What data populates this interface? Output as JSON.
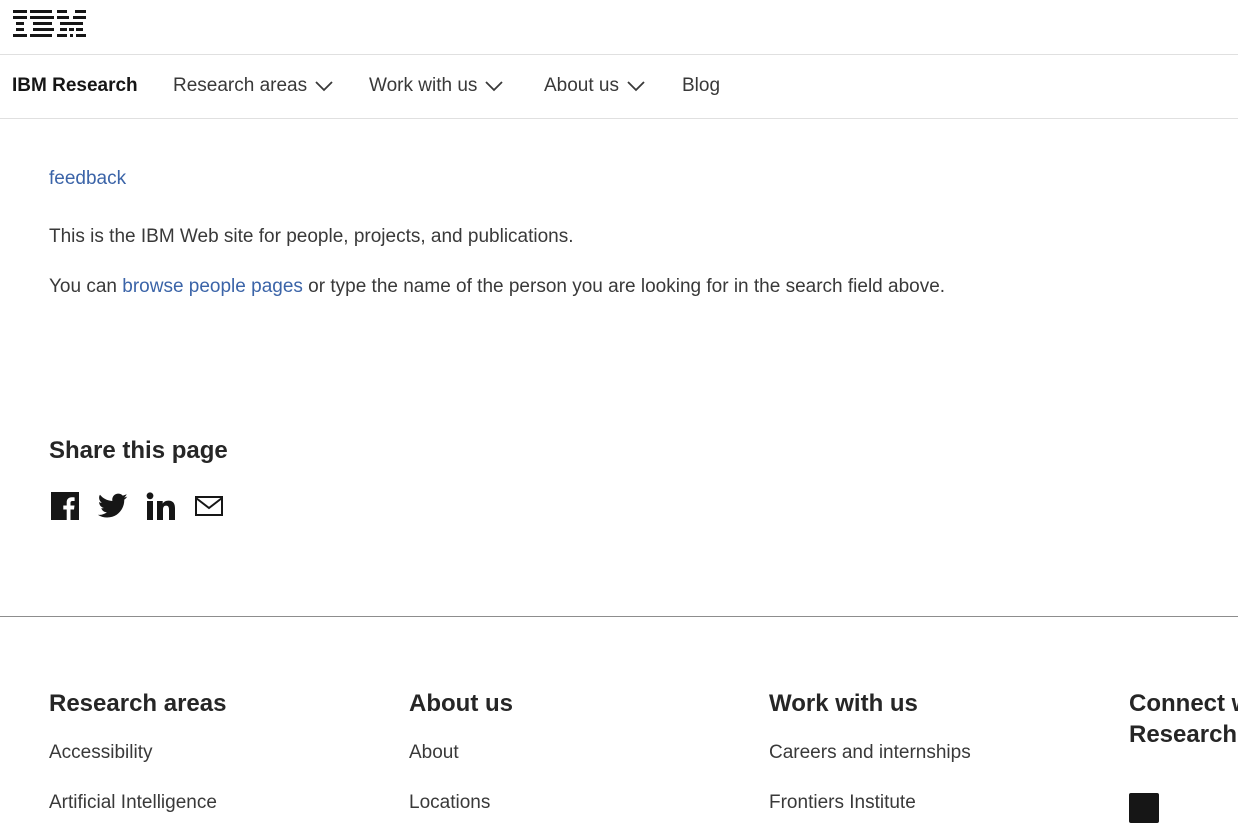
{
  "masthead": {
    "logo_text": "IBM"
  },
  "subnav": {
    "brand": "IBM Research",
    "items": [
      {
        "label": "Research areas",
        "has_dropdown": true
      },
      {
        "label": "Work with us",
        "has_dropdown": true
      },
      {
        "label": "About us",
        "has_dropdown": true
      },
      {
        "label": "Blog",
        "has_dropdown": false
      }
    ]
  },
  "main": {
    "feedback_link": "feedback",
    "intro": "This is the IBM Web site for people, projects, and publications.",
    "browse_prefix": "You can ",
    "browse_link": "browse people pages",
    "browse_suffix": " or type the name of the person you are looking for in the search field above."
  },
  "share": {
    "title": "Share this page",
    "icons": [
      "facebook-icon",
      "twitter-icon",
      "linkedin-icon",
      "email-icon"
    ]
  },
  "footer": {
    "columns": [
      {
        "heading": "Research areas",
        "links": [
          "Accessibility",
          "Artificial Intelligence"
        ]
      },
      {
        "heading": "About us",
        "links": [
          "About",
          "Locations"
        ]
      },
      {
        "heading": "Work with us",
        "links": [
          "Careers and internships",
          "Frontiers Institute"
        ]
      },
      {
        "heading": "Connect with IBM Research",
        "links": []
      }
    ]
  },
  "colors": {
    "link": "#3b64a8",
    "text": "#393939",
    "heading": "#262626"
  }
}
